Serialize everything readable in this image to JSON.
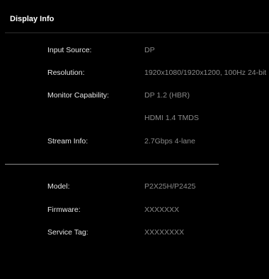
{
  "panel": {
    "title": "Display Info"
  },
  "rows": {
    "input_source": {
      "label": "Input Source:",
      "value": "DP"
    },
    "resolution": {
      "label": "Resolution:",
      "value": "1920x1080/1920x1200, 100Hz 24-bit"
    },
    "monitor_capability": {
      "label": "Monitor Capability:",
      "value": "DP 1.2 (HBR)",
      "value_2": "HDMI 1.4 TMDS"
    },
    "stream_info": {
      "label": "Stream Info:",
      "value": "2.7Gbps 4-lane"
    },
    "model": {
      "label": "Model:",
      "value": "P2X25H/P2425"
    },
    "firmware": {
      "label": "Firmware:",
      "value": "XXXXXXX"
    },
    "service_tag": {
      "label": "Service Tag:",
      "value": "XXXXXXXX"
    }
  }
}
